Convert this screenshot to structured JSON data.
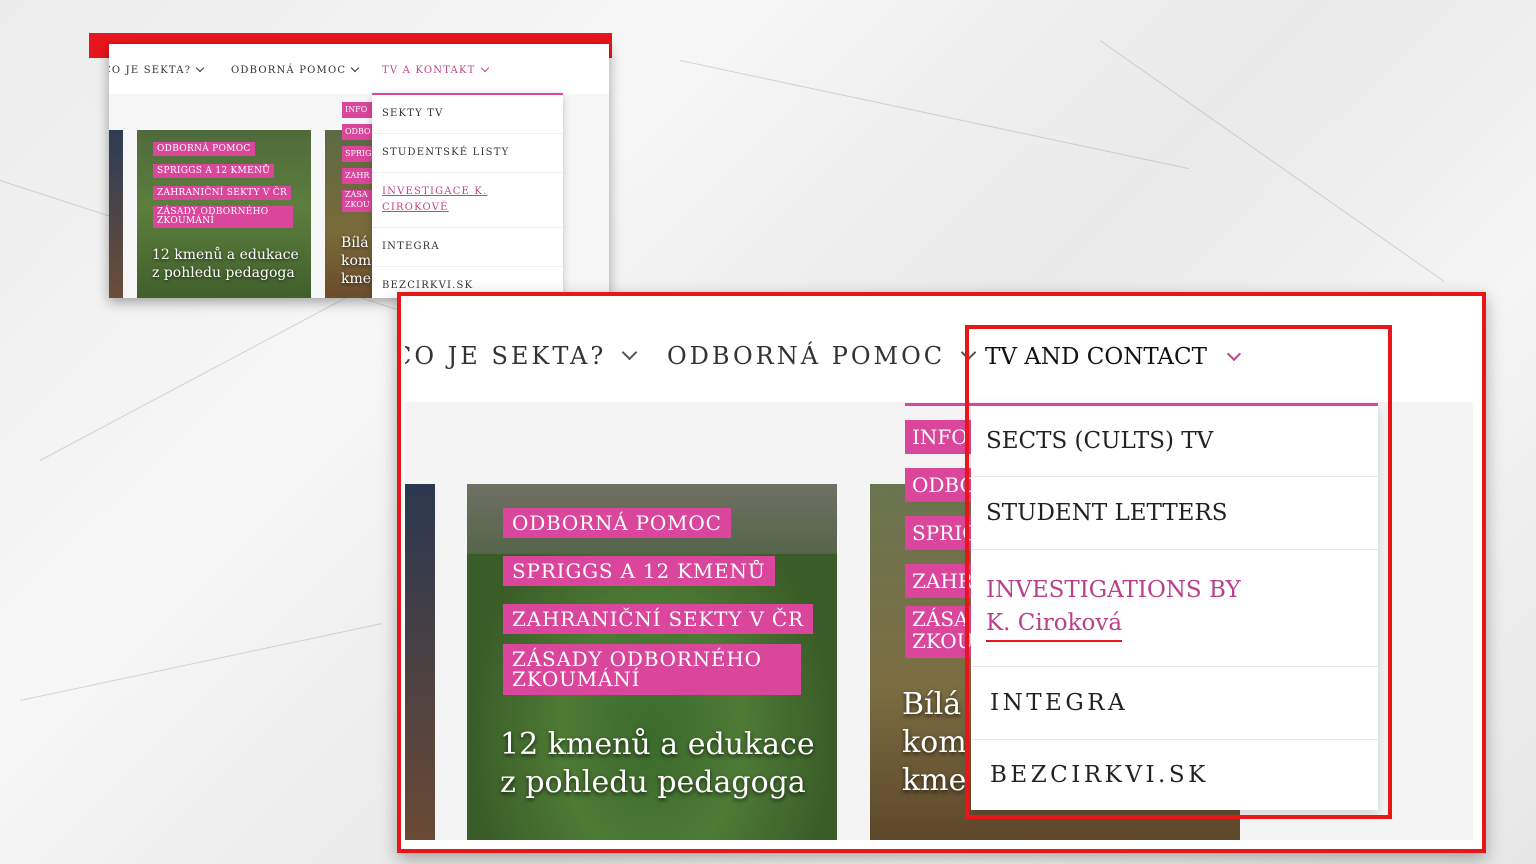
{
  "small": {
    "nav": [
      {
        "label": "CO JE SEKTA?"
      },
      {
        "label": "ODBORNÁ POMOC"
      },
      {
        "label": "TV A KONTAKT"
      }
    ],
    "dropdown": [
      "SEKTY TV",
      "STUDENTSKÉ LISTY",
      "INVESTIGACE K. CIROKOVÉ",
      "INTEGRA",
      "BEZCIRKVI.SK"
    ],
    "strips": [
      "INFO",
      "ODBO",
      "SPRIG",
      "ZAHR",
      "ZÁSA ZKOU"
    ],
    "card1": {
      "tags": [
        "ODBORNÁ POMOC",
        "SPRIGGS A 12 KMENŮ",
        "ZAHRANIČNÍ SEKTY V ČR",
        "ZÁSADY ODBORNÉHO ZKOUMÁNÍ"
      ],
      "title": "12 kmenů a edukace z pohledu pedagoga"
    },
    "card2": {
      "title": "Bílá kom kme"
    }
  },
  "big": {
    "nav": [
      {
        "label": "CO JE SEKTA?"
      },
      {
        "label": "ODBORNÁ POMOC"
      }
    ],
    "active_nav": "TV AND CONTACT",
    "dropdown": [
      {
        "label": "SECTS (CULTS) TV"
      },
      {
        "label": "STUDENT LETTERS"
      },
      {
        "line1": "INVESTIGATIONS BY",
        "line2": "K. Ciroková"
      },
      {
        "label": "INTEGRA"
      },
      {
        "label": "BEZCIRKVI.SK"
      }
    ],
    "strips": [
      "INFO",
      "ODBO",
      "SPRIG",
      "ZAHR",
      "ZÁSA",
      "ZKOU"
    ],
    "card1": {
      "tags": [
        "ODBORNÁ POMOC",
        "SPRIGGS A 12 KMENŮ",
        "ZAHRANIČNÍ SEKTY V ČR",
        "ZÁSADY ODBORNÉHO",
        "ZKOUMÁNÍ"
      ],
      "title_line1": "12 kmenů a edukace",
      "title_line2": "z pohledu pedagoga"
    },
    "card2": {
      "line1": "Bílá",
      "line2": "kom",
      "line3": "kme"
    }
  },
  "colors": {
    "accent": "#d9469b",
    "highlight": "#e8161b",
    "active_text": "#c0458a"
  }
}
